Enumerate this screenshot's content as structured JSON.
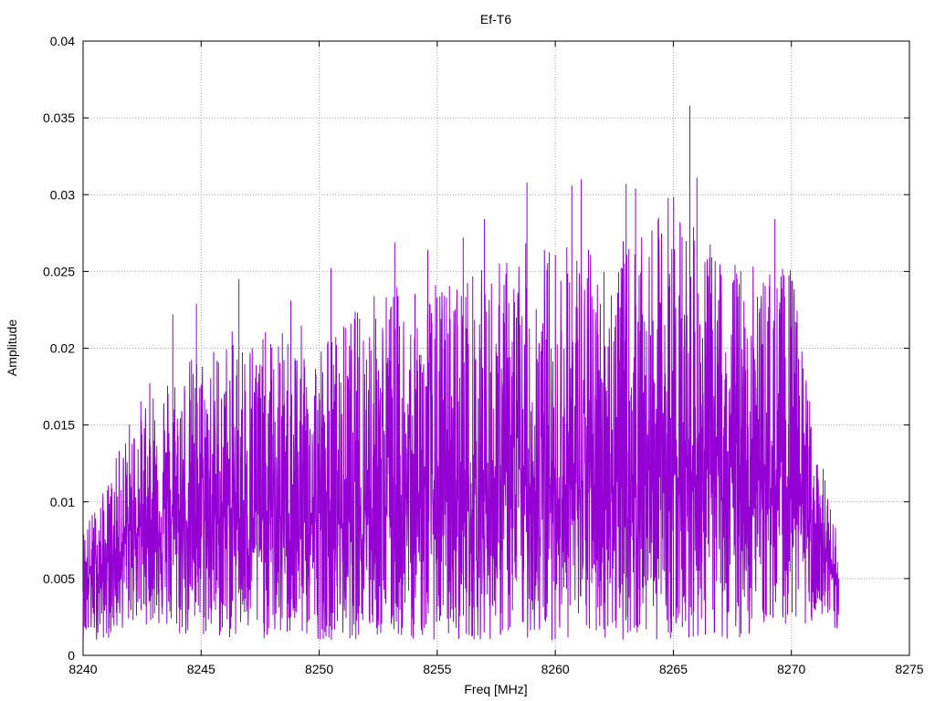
{
  "chart_data": {
    "type": "line",
    "title": "Ef-T6",
    "xlabel": "Freq [MHz]",
    "ylabel": "Amplitude",
    "xlim": [
      8240,
      8275
    ],
    "ylim": [
      0,
      0.04
    ],
    "xticks": [
      8240,
      8245,
      8250,
      8255,
      8260,
      8265,
      8270,
      8275
    ],
    "xtick_labels": [
      "8240",
      "8245",
      "8250",
      "8255",
      "8260",
      "8265",
      "8270",
      "8275"
    ],
    "yticks": [
      0,
      0.005,
      0.01,
      0.015,
      0.02,
      0.025,
      0.03,
      0.035,
      0.04
    ],
    "ytick_labels": [
      "0",
      "0.005",
      "0.01",
      "0.015",
      "0.02",
      "0.025",
      "0.03",
      "0.035",
      "0.04"
    ],
    "grid": true,
    "line_color": "#9400d3",
    "series": [
      {
        "name": "",
        "x_start": 8240,
        "x_end": 8272,
        "envelope_x": [
          8240,
          8241,
          8242,
          8243,
          8244,
          8245,
          8246,
          8247,
          8248,
          8249,
          8250,
          8251,
          8252,
          8253,
          8254,
          8255,
          8256,
          8257,
          8258,
          8259,
          8260,
          8261,
          8262,
          8263,
          8264,
          8265,
          8266,
          8267,
          8268,
          8269,
          8270,
          8271,
          8272
        ],
        "envelope_max": [
          0.009,
          0.012,
          0.017,
          0.02,
          0.021,
          0.022,
          0.023,
          0.024,
          0.023,
          0.024,
          0.023,
          0.024,
          0.026,
          0.027,
          0.026,
          0.027,
          0.028,
          0.028,
          0.029,
          0.03,
          0.03,
          0.03,
          0.029,
          0.03,
          0.03,
          0.035,
          0.03,
          0.029,
          0.028,
          0.028,
          0.028,
          0.016,
          0.008
        ],
        "envelope_min": [
          0.001,
          0.001,
          0.002,
          0.002,
          0.001,
          0.001,
          0.001,
          0.001,
          0.001,
          0.001,
          0.001,
          0.001,
          0.001,
          0.001,
          0.001,
          0.001,
          0.001,
          0.001,
          0.001,
          0.001,
          0.001,
          0.001,
          0.001,
          0.001,
          0.001,
          0.001,
          0.001,
          0.001,
          0.001,
          0.002,
          0.002,
          0.002,
          0.001
        ],
        "baseline": [
          0.005,
          0.006,
          0.008,
          0.009,
          0.009,
          0.009,
          0.009,
          0.009,
          0.009,
          0.009,
          0.009,
          0.009,
          0.01,
          0.01,
          0.01,
          0.01,
          0.01,
          0.01,
          0.011,
          0.011,
          0.011,
          0.011,
          0.011,
          0.011,
          0.012,
          0.012,
          0.012,
          0.012,
          0.012,
          0.011,
          0.011,
          0.008,
          0.004
        ],
        "peaks": [
          {
            "x": 8243.8,
            "y": 0.0222
          },
          {
            "x": 8244.8,
            "y": 0.0229
          },
          {
            "x": 8246.6,
            "y": 0.0245
          },
          {
            "x": 8248.8,
            "y": 0.0231
          },
          {
            "x": 8250.5,
            "y": 0.0252
          },
          {
            "x": 8253.2,
            "y": 0.0269
          },
          {
            "x": 8254.6,
            "y": 0.0264
          },
          {
            "x": 8256.1,
            "y": 0.0272
          },
          {
            "x": 8257.0,
            "y": 0.0284
          },
          {
            "x": 8258.8,
            "y": 0.0308
          },
          {
            "x": 8260.7,
            "y": 0.0306
          },
          {
            "x": 8261.1,
            "y": 0.031
          },
          {
            "x": 8263.0,
            "y": 0.0307
          },
          {
            "x": 8263.4,
            "y": 0.0304
          },
          {
            "x": 8265.7,
            "y": 0.0358
          },
          {
            "x": 8266.0,
            "y": 0.0311
          },
          {
            "x": 8269.3,
            "y": 0.0284
          }
        ]
      }
    ]
  }
}
